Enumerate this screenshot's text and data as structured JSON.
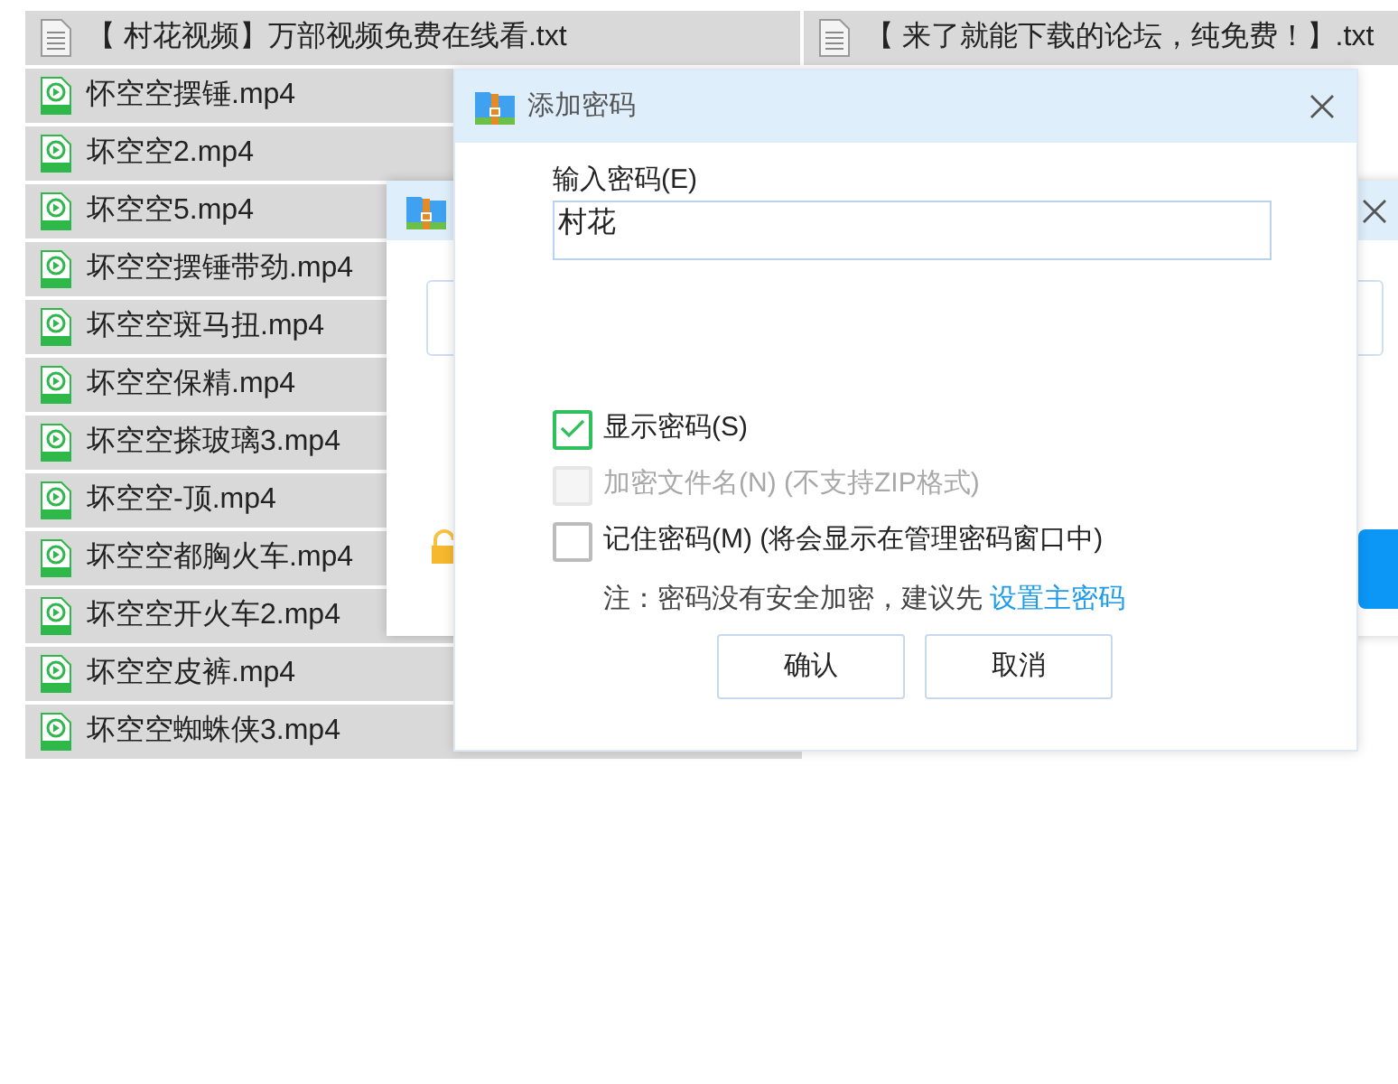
{
  "file_rows": [
    {
      "items": [
        {
          "kind": "txt",
          "name": "【 村花视频】万部视频免费在线看.txt"
        },
        {
          "kind": "txt",
          "name": "【 来了就能下载的论坛，纯免费！】.txt"
        }
      ]
    },
    {
      "items": [
        {
          "kind": "mp4",
          "name": "怀空空摆锤.mp4"
        }
      ]
    },
    {
      "items": [
        {
          "kind": "mp4",
          "name": "坏空空2.mp4"
        }
      ]
    },
    {
      "items": [
        {
          "kind": "mp4",
          "name": "坏空空5.mp4"
        }
      ]
    },
    {
      "items": [
        {
          "kind": "mp4",
          "name": "坏空空摆锤带劲.mp4"
        }
      ]
    },
    {
      "items": [
        {
          "kind": "mp4",
          "name": "坏空空斑马扭.mp4"
        }
      ]
    },
    {
      "items": [
        {
          "kind": "mp4",
          "name": "坏空空保精.mp4"
        }
      ]
    },
    {
      "items": [
        {
          "kind": "mp4",
          "name": "坏空空搽玻璃3.mp4"
        }
      ]
    },
    {
      "items": [
        {
          "kind": "mp4",
          "name": "坏空空-顶.mp4"
        }
      ]
    },
    {
      "items": [
        {
          "kind": "mp4",
          "name": "坏空空都胸火车.mp4"
        }
      ]
    },
    {
      "items": [
        {
          "kind": "mp4",
          "name": "坏空空开火车2.mp4"
        }
      ]
    },
    {
      "items": [
        {
          "kind": "mp4",
          "name": "坏空空皮裤.mp4"
        }
      ]
    },
    {
      "items": [
        {
          "kind": "mp4",
          "name": "坏空空蜘蛛侠3.mp4"
        }
      ]
    }
  ],
  "dialog": {
    "title": "添加密码",
    "password_label": "输入密码(E)",
    "password_value": "村花",
    "options": [
      {
        "label": "显示密码(S)",
        "checked": true,
        "disabled": false
      },
      {
        "label": "加密文件名(N) (不支持ZIP格式)",
        "checked": false,
        "disabled": true
      },
      {
        "label": "记住密码(M) (将会显示在管理密码窗口中)",
        "checked": false,
        "disabled": false
      }
    ],
    "note": "注：密码没有安全加密，建议先",
    "note_link": "设置主密码",
    "buttons": [
      "确认",
      "取消"
    ]
  }
}
